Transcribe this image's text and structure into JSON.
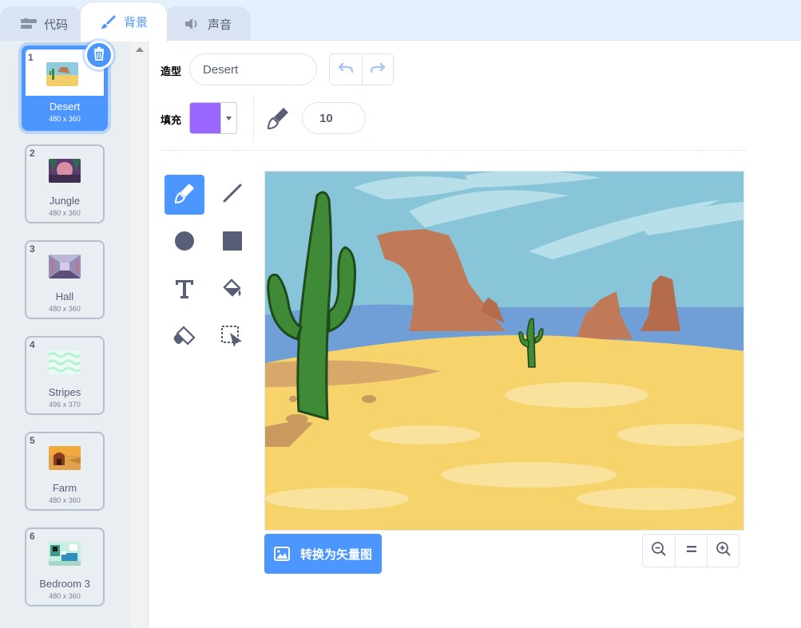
{
  "tabs": {
    "code": "代码",
    "backdrops": "背景",
    "sounds": "声音"
  },
  "backdrops": [
    {
      "num": "1",
      "name": "Desert",
      "size": "480 x 360",
      "selected": true
    },
    {
      "num": "2",
      "name": "Jungle",
      "size": "480 x 360"
    },
    {
      "num": "3",
      "name": "Hall",
      "size": "480 x 360"
    },
    {
      "num": "4",
      "name": "Stripes",
      "size": "496 x 370"
    },
    {
      "num": "5",
      "name": "Farm",
      "size": "480 x 360"
    },
    {
      "num": "6",
      "name": "Bedroom 3",
      "size": "480 x 360"
    }
  ],
  "editor": {
    "costume_label": "造型",
    "costume_name": "Desert",
    "fill_label": "填充",
    "fill_color": "#9966ff",
    "brush_size": "10",
    "convert_label": "转换为矢量图"
  },
  "icons": {
    "undo": "undo-icon",
    "redo": "redo-icon",
    "delete": "trash-icon",
    "tools": [
      "brush-icon",
      "line-icon",
      "circle-icon",
      "rectangle-icon",
      "text-icon",
      "fill-icon",
      "eraser-icon",
      "select-icon"
    ],
    "zoom": [
      "zoom-out-icon",
      "zoom-reset-icon",
      "zoom-in-icon"
    ]
  },
  "colors": {
    "accent": "#4c97ff",
    "tab_bar": "#e5f0ff",
    "sidebar": "#e9eef2"
  }
}
